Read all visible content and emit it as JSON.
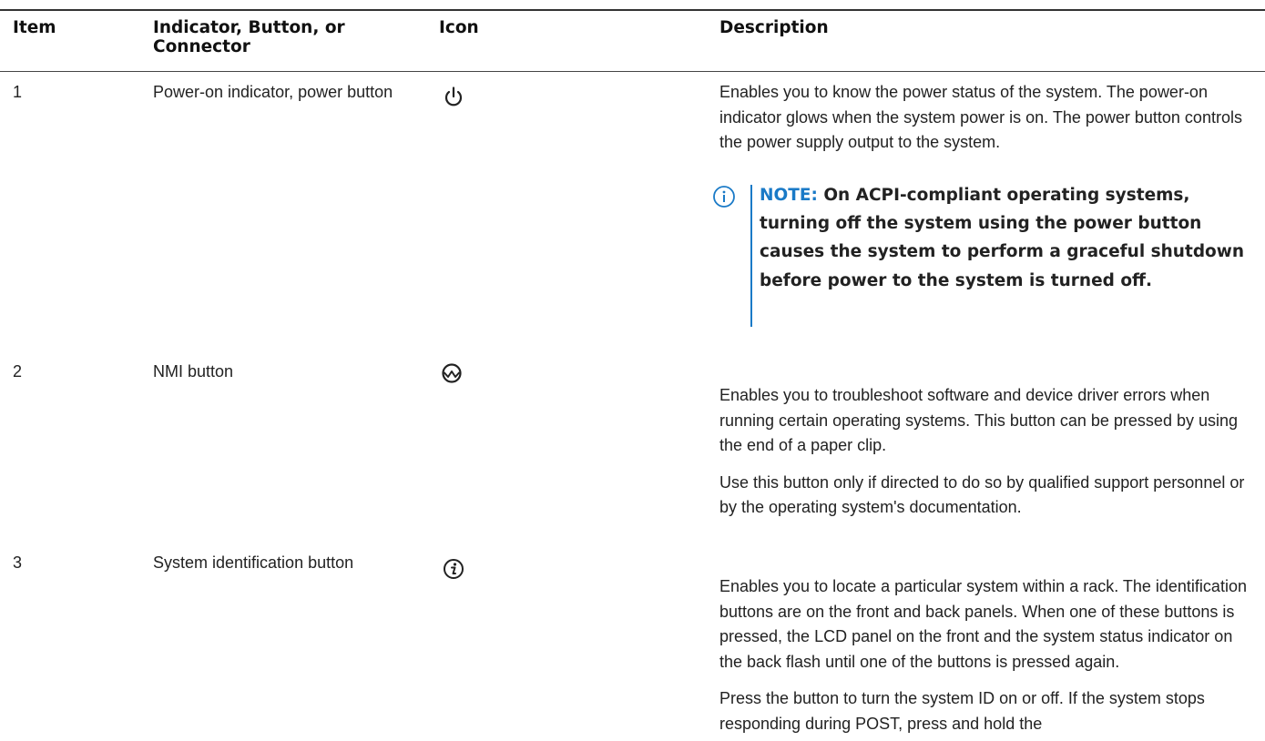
{
  "table": {
    "headers": {
      "item": "Item",
      "indicator": "Indicator, Button, or Connector",
      "icon": "Icon",
      "description": "Description"
    },
    "rows": [
      {
        "item": "1",
        "name": "Power-on indicator, power button",
        "icon": "power-icon",
        "description": "Enables you to know the power status of the system. The power-on indicator glows when the system power is on. The power button controls the power supply output to the system.",
        "note_label": "NOTE:",
        "note_text": "On ACPI-compliant operating systems, turning off the system using the power button causes the system to perform a graceful shutdown before power to the system is turned off."
      },
      {
        "item": "2",
        "name": "NMI button",
        "icon": "nmi-icon",
        "description": "Enables you to troubleshoot software and device driver errors when running certain operating systems. This button can be pressed by using the end of a paper clip.",
        "description2": "Use this button only if directed to do so by qualified support personnel or by the operating system's documentation."
      },
      {
        "item": "3",
        "name": "System identification button",
        "icon": "system-id-icon",
        "description": "Enables you to locate a particular system within a rack. The identification buttons are on the front and back panels. When one of these buttons is pressed, the LCD panel on the front and the system status indicator on the back flash until one of the buttons is pressed again.",
        "description2": "Press the button to turn the system ID on or off. If the system stops responding during POST, press and hold the"
      }
    ]
  },
  "colors": {
    "accent": "#1a7ac7",
    "text": "#222222",
    "rule": "#333333"
  }
}
